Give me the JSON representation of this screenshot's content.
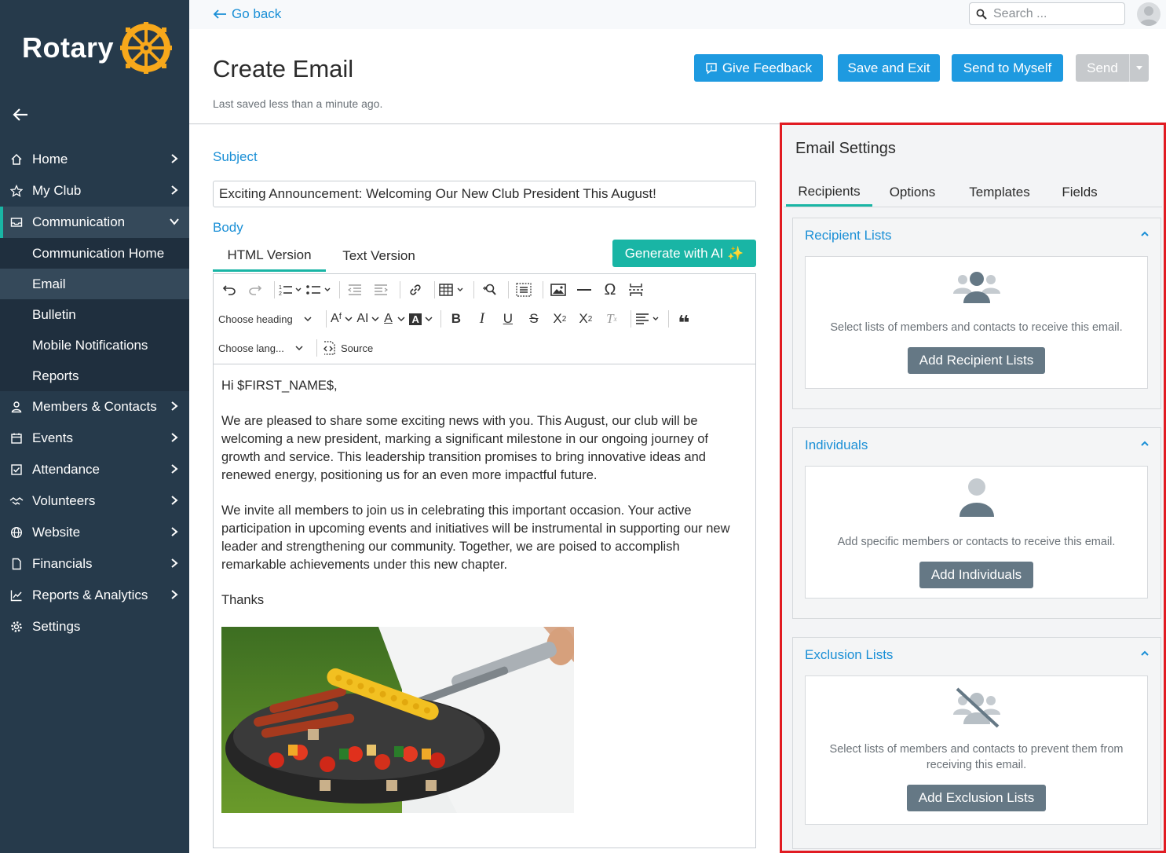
{
  "brand": {
    "name": "Rotary",
    "accent": "#19b5a5",
    "link_color": "#1a8fd6",
    "highlight_border": "#e11b22"
  },
  "sidebar": {
    "items": [
      {
        "label": "Home",
        "icon": "home-icon"
      },
      {
        "label": "My Club",
        "icon": "star-icon"
      },
      {
        "label": "Communication",
        "icon": "mail-icon"
      },
      {
        "label": "Members & Contacts",
        "icon": "person-icon"
      },
      {
        "label": "Events",
        "icon": "calendar-icon"
      },
      {
        "label": "Attendance",
        "icon": "checkbox-icon"
      },
      {
        "label": "Volunteers",
        "icon": "handshake-icon"
      },
      {
        "label": "Website",
        "icon": "globe-icon"
      },
      {
        "label": "Financials",
        "icon": "document-icon"
      },
      {
        "label": "Reports & Analytics",
        "icon": "chart-icon"
      },
      {
        "label": "Settings",
        "icon": "gear-icon"
      }
    ],
    "communication_sub": [
      "Communication Home",
      "Email",
      "Bulletin",
      "Mobile Notifications",
      "Reports"
    ]
  },
  "topbar": {
    "go_back": "Go back",
    "search_placeholder": "Search ..."
  },
  "header": {
    "title": "Create Email",
    "last_saved": "Last saved less than a minute ago.",
    "buttons": {
      "feedback": "Give Feedback",
      "save_exit": "Save and Exit",
      "send_myself": "Send to Myself",
      "send": "Send"
    }
  },
  "editor": {
    "subject_label": "Subject",
    "subject_value": "Exciting Announcement: Welcoming Our New Club President This August!",
    "body_label": "Body",
    "tabs": [
      "HTML Version",
      "Text Version"
    ],
    "generate_ai": "Generate with AI ✨",
    "toolbar": {
      "heading": "Choose heading",
      "language": "Choose lang...",
      "source": "Source"
    },
    "body": {
      "greeting": "Hi $FIRST_NAME$,",
      "para1": "We are pleased to share some exciting news with you. This August, our club will be welcoming a new president, marking a significant milestone in our ongoing journey of growth and service. This leadership transition promises to bring innovative ideas and renewed energy, positioning us for an even more impactful future.",
      "para2": "We invite all members to join us in celebrating this important occasion. Your active participation in upcoming events and initiatives will be instrumental in supporting our new leader and strengthening our community. Together, we are poised to accomplish remarkable achievements under this new chapter.",
      "signoff": "Thanks"
    }
  },
  "settings": {
    "title": "Email Settings",
    "tabs": [
      "Recipients",
      "Options",
      "Templates",
      "Fields"
    ],
    "recipient_lists": {
      "title": "Recipient Lists",
      "desc": "Select lists of members and contacts to receive this email.",
      "button": "Add Recipient Lists"
    },
    "individuals": {
      "title": "Individuals",
      "desc": "Add specific members or contacts to receive this email.",
      "button": "Add Individuals"
    },
    "exclusion_lists": {
      "title": "Exclusion Lists",
      "desc": "Select lists of members and contacts to prevent them from receiving this email.",
      "button": "Add Exclusion Lists"
    }
  }
}
